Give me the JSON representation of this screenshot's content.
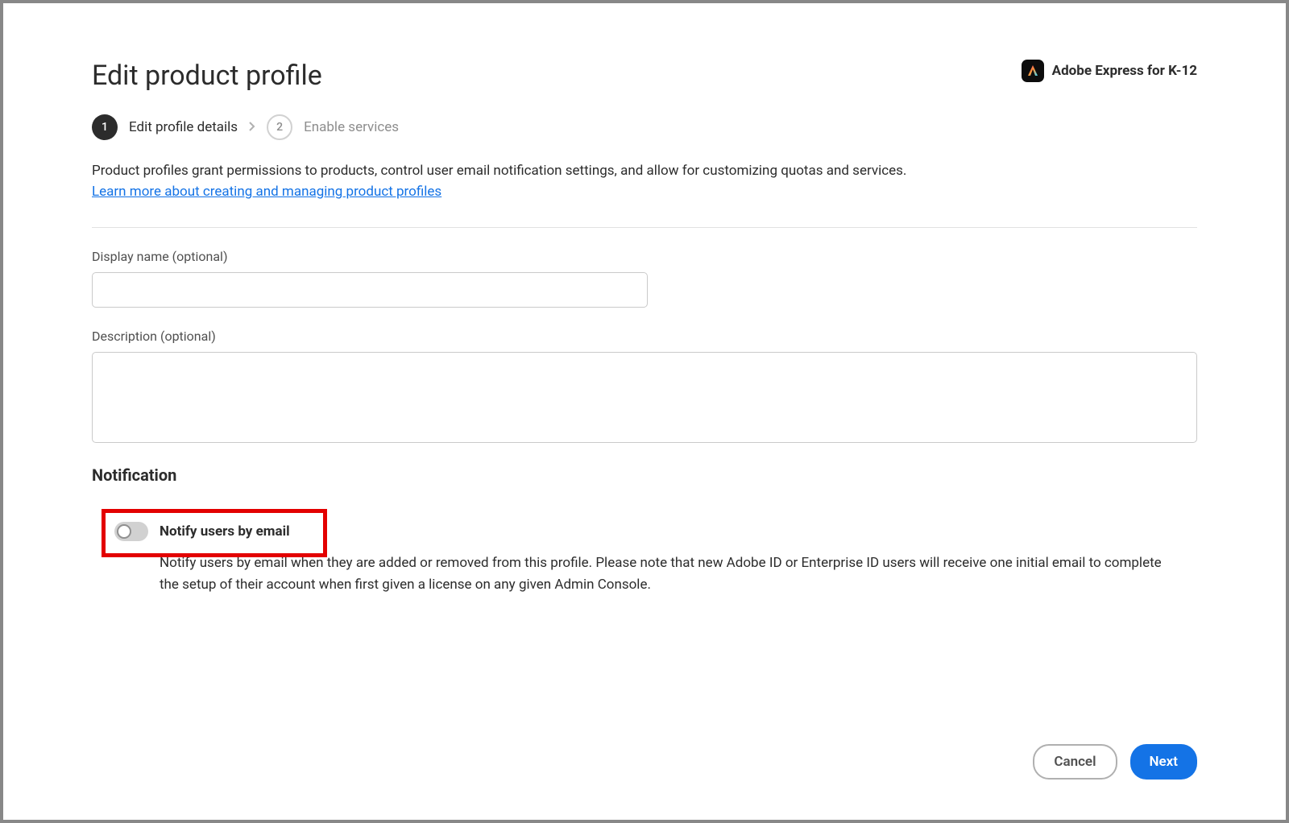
{
  "modal": {
    "title": "Edit product profile",
    "product_name": "Adobe Express for K-12"
  },
  "stepper": {
    "step1_num": "1",
    "step1_label": "Edit profile details",
    "step2_num": "2",
    "step2_label": "Enable services"
  },
  "intro": {
    "text": "Product profiles grant permissions to products, control user email notification settings, and allow for customizing quotas and services.",
    "link_text": "Learn more about creating and managing product profiles"
  },
  "form": {
    "display_name_label": "Display name (optional)",
    "display_name_value": "",
    "description_label": "Description (optional)",
    "description_value": ""
  },
  "notification": {
    "heading": "Notification",
    "toggle_label": "Notify users by email",
    "toggle_state": false,
    "desc": "Notify users by email when they are added or removed from this profile. Please note that new Adobe ID or Enterprise ID users will receive one initial email to complete the setup of their account when first given a license on any given Admin Console."
  },
  "footer": {
    "cancel_label": "Cancel",
    "next_label": "Next"
  },
  "colors": {
    "accent": "#1473e6",
    "highlight": "#e30000"
  }
}
